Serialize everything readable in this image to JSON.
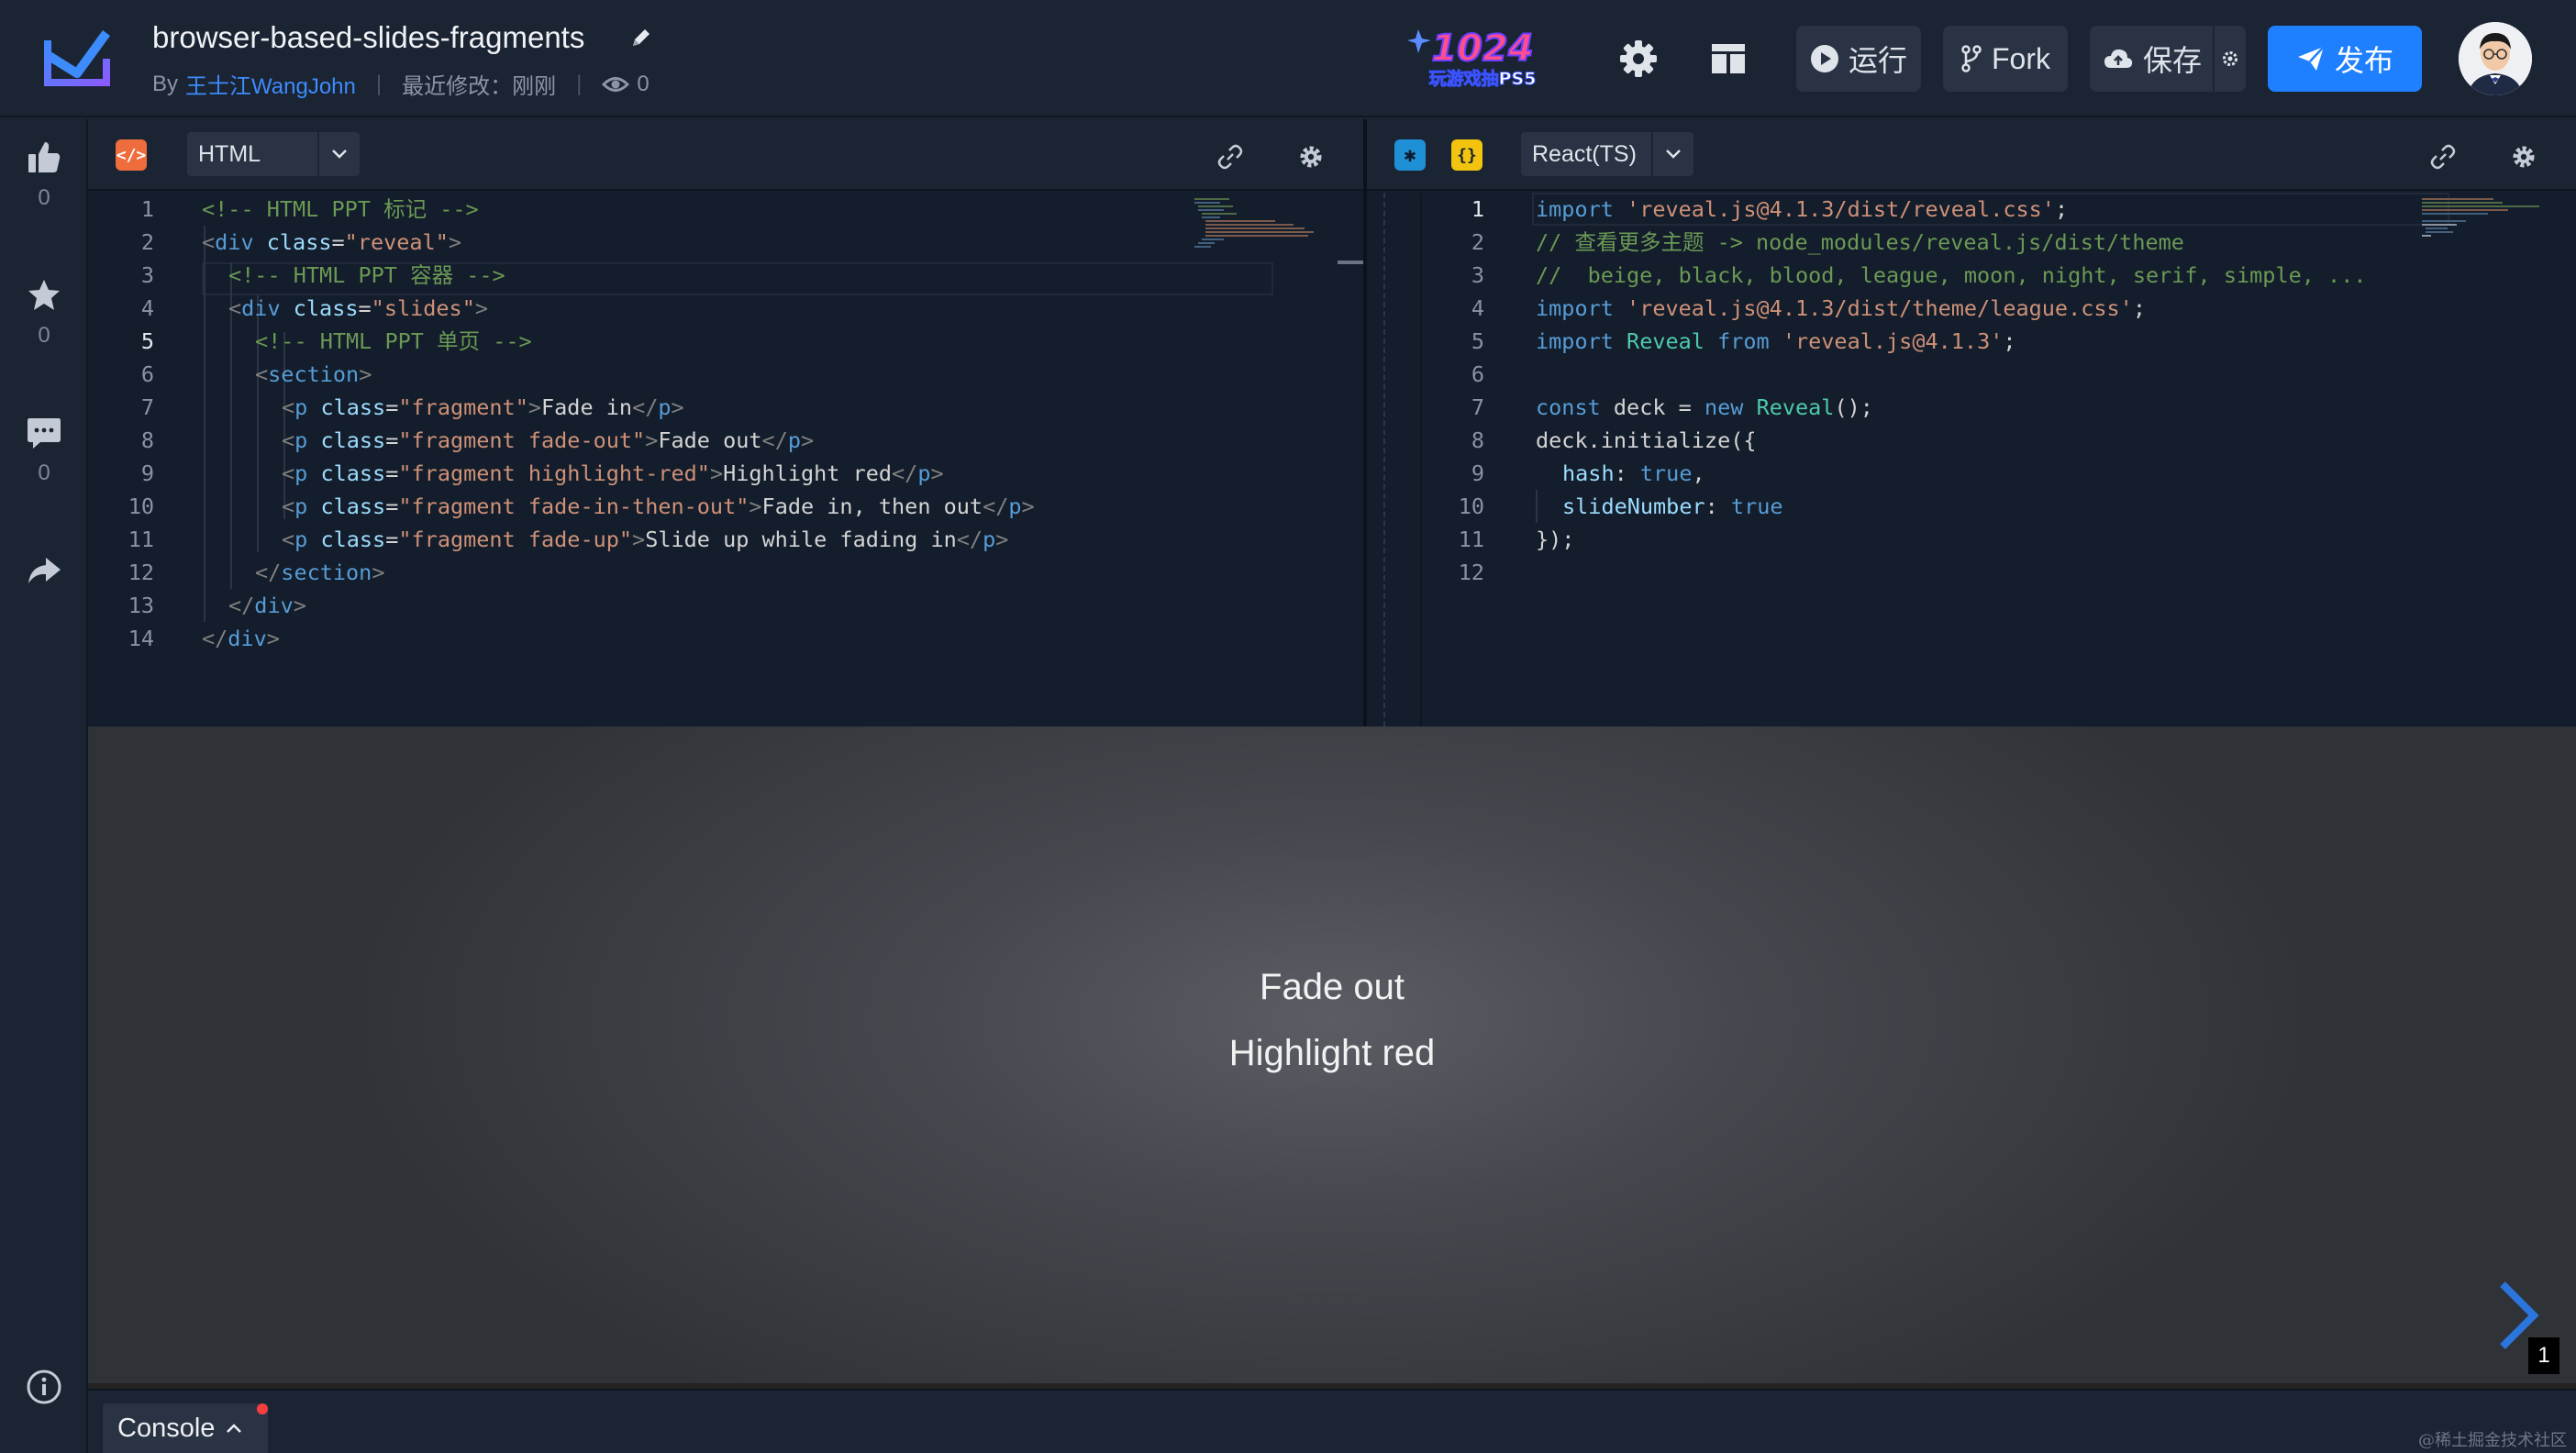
{
  "header": {
    "title": "browser-based-slides-fragments",
    "by_label": "By",
    "author": "王士江WangJohn",
    "last_modified_label": "最近修改：",
    "last_modified_value": "刚刚",
    "views": "0",
    "promo_title": "1024",
    "promo_subtitle": "玩游戏抽PS5",
    "run_label": "运行",
    "fork_label": "Fork",
    "save_label": "保存",
    "publish_label": "发布"
  },
  "rail": {
    "like_count": "0",
    "star_count": "0",
    "comment_count": "0"
  },
  "html_pane": {
    "language": "HTML",
    "badge": "</>",
    "active_line": 5
  },
  "ts_pane": {
    "language": "React(TS)",
    "badge": "{}",
    "active_line": 1
  },
  "preview": {
    "lines": [
      "Fade out",
      "Highlight red"
    ],
    "slide_number": "1"
  },
  "bottom": {
    "console_label": "Console",
    "watermark": "@稀土掘金技术社区"
  },
  "colors": {
    "accent": "#1e80ff",
    "brand_logo": "#7b5cff",
    "bg": "#1b2433",
    "editor_bg": "#141d2b",
    "arrow": "#2a76dd"
  }
}
